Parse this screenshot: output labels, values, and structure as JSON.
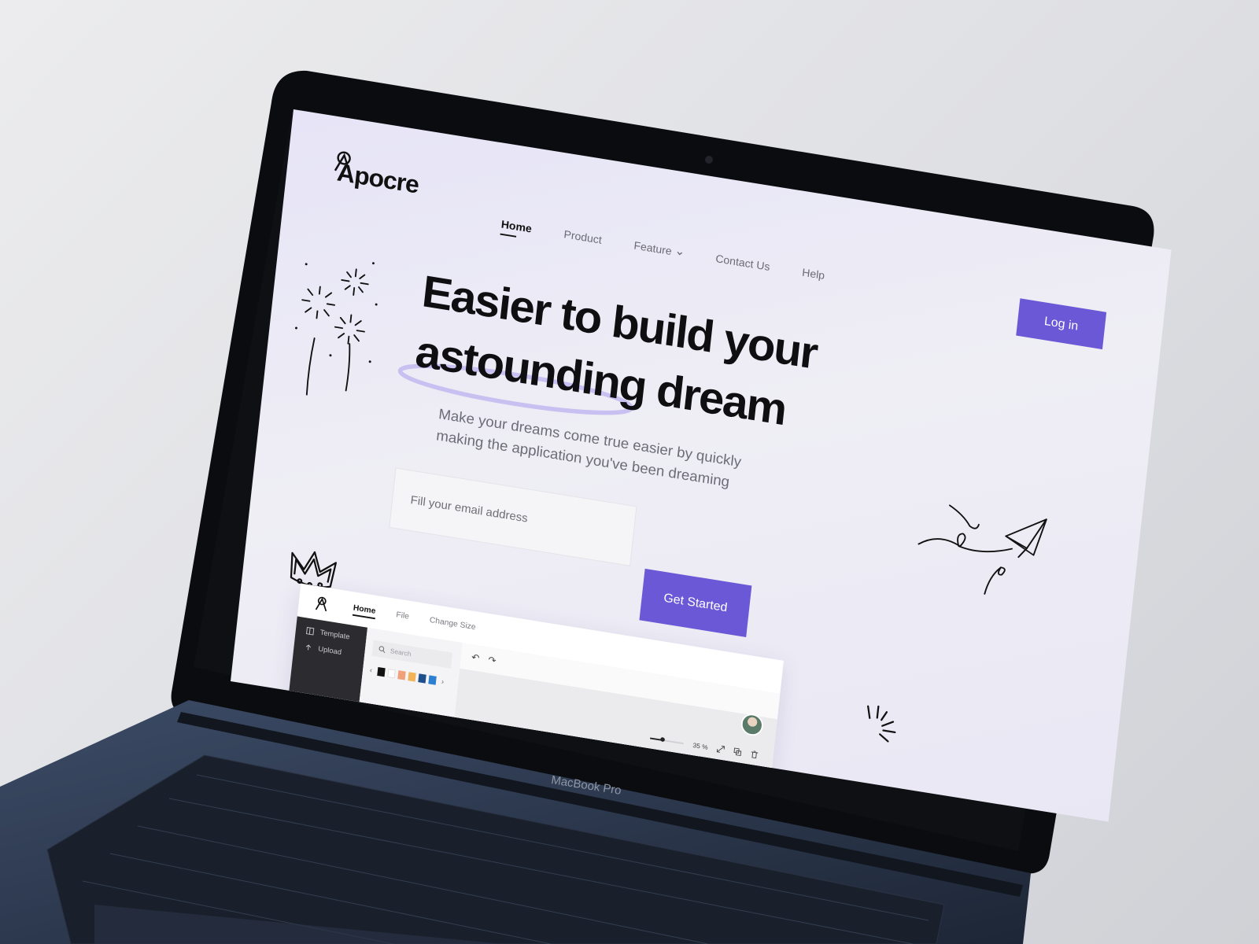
{
  "brand": {
    "name": "Apocre"
  },
  "nav": {
    "items": [
      {
        "label": "Home",
        "active": true
      },
      {
        "label": "Product",
        "active": false
      },
      {
        "label": "Feature",
        "active": false,
        "has_dropdown": true
      },
      {
        "label": "Contact Us",
        "active": false
      },
      {
        "label": "Help",
        "active": false
      }
    ],
    "login_label": "Log in"
  },
  "hero": {
    "line1": "Easier to build your",
    "line2": "astounding dream",
    "subtitle": "Make your dreams come true easier by quickly making the application you've been dreaming"
  },
  "signup": {
    "email_placeholder": "Fill your email address",
    "cta_label": "Get Started"
  },
  "preview": {
    "tabs": [
      {
        "label": "Home",
        "active": true
      },
      {
        "label": "File",
        "active": false
      },
      {
        "label": "Change Size",
        "active": false
      }
    ],
    "sidebar": [
      {
        "label": "Template",
        "icon": "template-icon"
      },
      {
        "label": "Upload",
        "icon": "upload-icon"
      }
    ],
    "search_placeholder": "Search",
    "swatches": [
      "#111111",
      "#f0a07a",
      "#f2b45a",
      "#1f4e8c",
      "#2d7fd1"
    ],
    "zoom_label": "35 %",
    "zoom_level": 0.35
  },
  "device": {
    "label": "MacBook Pro"
  },
  "colors": {
    "accent": "#6a58d6",
    "ink": "#0f0f12",
    "muted": "#6c6c76"
  }
}
